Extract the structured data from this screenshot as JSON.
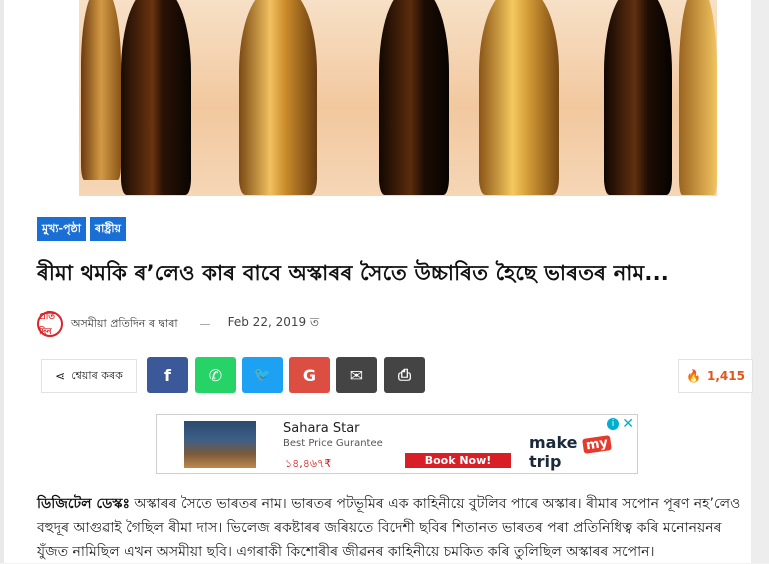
{
  "categories": [
    "মুখ্য-পৃষ্ঠা",
    "ৰাষ্ট্ৰীয়"
  ],
  "article": {
    "title": "ৰীমা থমকি ৰ’লেও কাৰ বাবে অস্কাৰৰ সৈতে উচ্চাৰিত হৈছে ভাৰতৰ নাম...",
    "author_logo": "প্ৰতি দিন",
    "author": "অসমীয়া প্ৰতিদিন ৰ দ্বাৰা",
    "date": "Feb 22, 2019 ত",
    "lead": "ডিজিটেল ডেস্কঃ",
    "body": "অস্কাৰৰ সৈতে ভাৰতৰ নাম। ভাৰতৰ পটভূমিৰ এক কাহিনীয়ে বুটলিব পাৰে অস্কাৰ। ৰীমাৰ সপোন পূৰণ নহ’লেও বহুদূৰ আগুৱাই গৈছিল ৰীমা দাস। ভিলেজ ৰকষ্টাৰৰ জৰিয়তে বিদেশী ছবিৰ শিতানত ভাৰতৰ পৰা প্ৰতিনিধিত্ব কৰি মনোনয়নৰ যুঁজত নামিছিল এখন অসমীয়া ছবি। এগৰাকী কিশোৰীৰ জীৱনৰ কাহিনীয়ে চমকিত কৰি তুলিছিল অস্কাৰৰ সপোন।"
  },
  "share": {
    "label": "শ্বেয়াৰ কৰক",
    "buttons": [
      {
        "name": "facebook",
        "glyph": "f",
        "color": "#3b5998"
      },
      {
        "name": "whatsapp",
        "glyph": "✆",
        "color": "#25d366"
      },
      {
        "name": "twitter",
        "glyph": "🐦",
        "color": "#1da1f2"
      },
      {
        "name": "google",
        "glyph": "G",
        "color": "#dc4e41"
      },
      {
        "name": "email",
        "glyph": "✉",
        "color": "#444"
      },
      {
        "name": "print",
        "glyph": "⎙",
        "color": "#444"
      }
    ],
    "view_count": "1,415"
  },
  "ad": {
    "hotel_name": "Sahara Star",
    "tagline": "Best Price Gurantee",
    "price": "১৪,৪৬৭₹",
    "cta": "Book Now!",
    "brand_prefix": "make",
    "brand_my": "my",
    "brand_suffix": "trip",
    "info": "i",
    "close": "✕"
  }
}
